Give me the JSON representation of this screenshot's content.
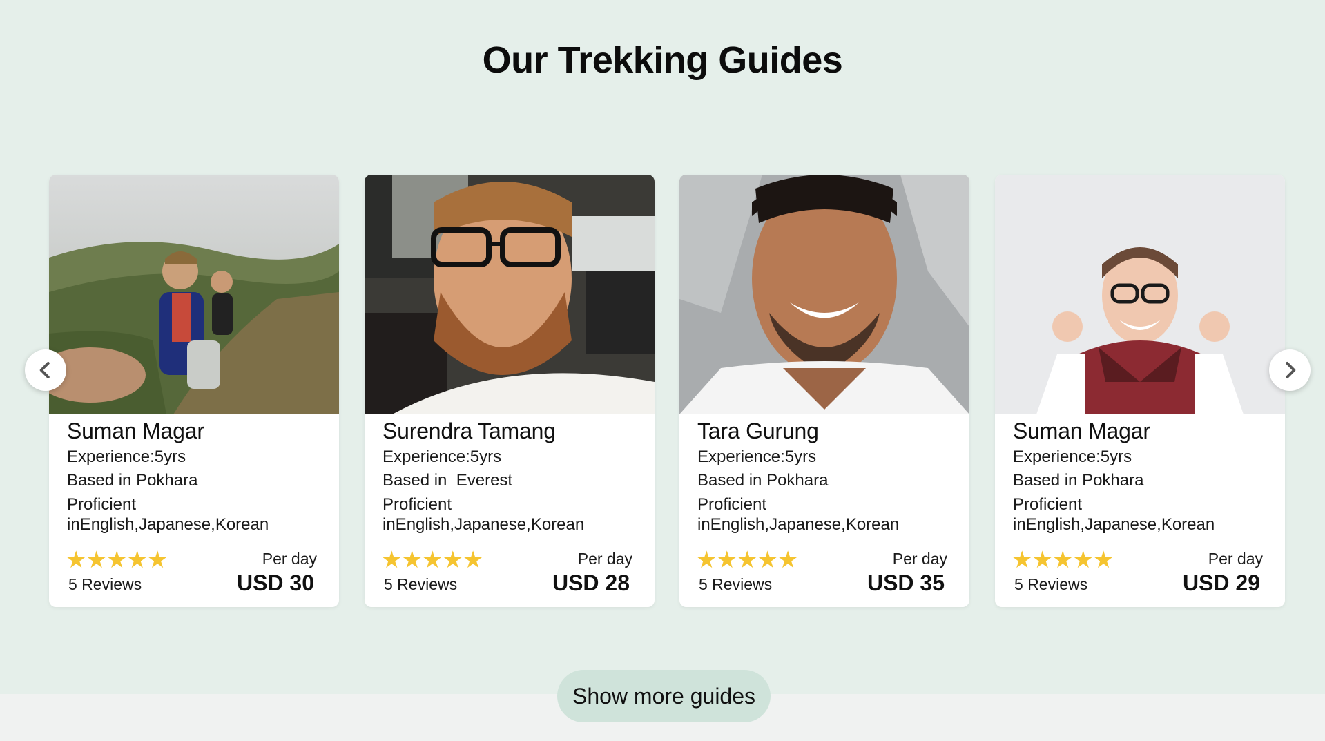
{
  "page": {
    "title": "Our Trekking Guides"
  },
  "guides": [
    {
      "name": "Suman Magar",
      "experience": "Experience:5yrs",
      "based": "Based in Pokhara",
      "proficient": "Proficient",
      "languages": "inEnglish,Japanese,Korean",
      "stars": "★★★★★",
      "rating": 5,
      "reviews": "5 Reviews",
      "per_day_label": "Per day",
      "price": "USD 30",
      "photo": "selfie-hiker-on-mountain-trail"
    },
    {
      "name": "Surendra Tamang",
      "experience": "Experience:5yrs",
      "based": "Based in  Everest",
      "proficient": "Proficient",
      "languages": "inEnglish,Japanese,Korean",
      "stars": "★★★★★",
      "rating": 5,
      "reviews": "5 Reviews",
      "per_day_label": "Per day",
      "price": "USD 28",
      "photo": "bearded-man-with-glasses"
    },
    {
      "name": "Tara Gurung",
      "experience": "Experience:5yrs",
      "based": "Based in Pokhara",
      "proficient": "Proficient",
      "languages": "inEnglish,Japanese,Korean",
      "stars": "★★★★★",
      "rating": 5,
      "reviews": "5 Reviews",
      "per_day_label": "Per day",
      "price": "USD 35",
      "photo": "smiling-man-white-tshirt"
    },
    {
      "name": "Suman Magar",
      "experience": "Experience:5yrs",
      "based": "Based in Pokhara",
      "proficient": "Proficient",
      "languages": "inEnglish,Japanese,Korean",
      "stars": "★★★★★",
      "rating": 5,
      "reviews": "5 Reviews",
      "per_day_label": "Per day",
      "price": "USD 29",
      "photo": "cheering-woman-with-scarf"
    }
  ],
  "carousel": {
    "prev_icon": "chevron-left-icon",
    "next_icon": "chevron-right-icon"
  },
  "actions": {
    "show_more_label": "Show more guides"
  },
  "colors": {
    "background": "#e5efea",
    "star": "#f5c430",
    "button": "#cfe3da"
  }
}
